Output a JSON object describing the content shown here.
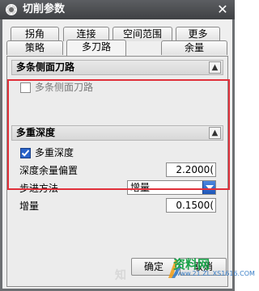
{
  "window": {
    "title": "切削参数",
    "close_glyph": "✕"
  },
  "tabs_row1": [
    "拐角",
    "连接",
    "空间范围",
    "更多"
  ],
  "tabs_row2": [
    "策略",
    "多刀路",
    "余量"
  ],
  "active_tab": "多刀路",
  "group_side_paths": {
    "header": "多条侧面刀路",
    "collapse_glyph": "▲",
    "checkbox_label": "多条侧面刀路",
    "checked": false
  },
  "group_depth": {
    "header": "多重深度",
    "collapse_glyph": "▲",
    "checkbox_label": "多重深度",
    "checked": true,
    "depth_offset_label": "深度余量偏置",
    "depth_offset_value": "2.2000(",
    "step_method_label": "步进方法",
    "step_method_value": "增量",
    "increment_label": "增量",
    "increment_value": "0.1500("
  },
  "footer": {
    "ok_label": "确定",
    "cancel_label": "取消"
  },
  "watermark": {
    "zhi": "知",
    "site": "资料网",
    "url": "www.21.ZL.XS1616.COM"
  },
  "colors": {
    "highlight_box": "#e0303a",
    "title_bar": "#4b4d50",
    "checkbox_checked": "#2a64c9"
  }
}
